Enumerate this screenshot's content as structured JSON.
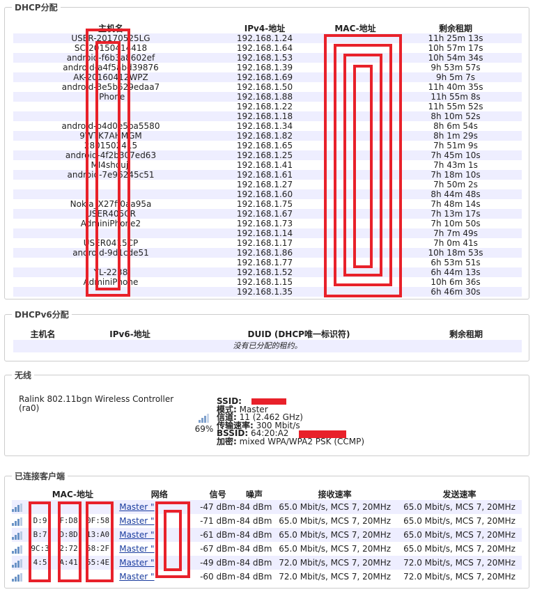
{
  "dhcp": {
    "title": "DHCP分配",
    "headers": [
      "主机名",
      "IPv4-地址",
      "MAC-地址",
      "剩余租期"
    ],
    "rows": [
      [
        "USER-20170525LG",
        "192.168.1.24",
        "",
        "11h 25m 13s"
      ],
      [
        "SC-20150414418",
        "192.168.1.64",
        "",
        "10h 57m 17s"
      ],
      [
        "android-f6b3a8602ef",
        "192.168.1.53",
        "",
        "10h 54m 34s"
      ],
      [
        "android-a4f5abd39876",
        "192.168.1.39",
        "",
        "9h 53m 57s"
      ],
      [
        "AK-20160412WPZ",
        "192.168.1.69",
        "",
        "9h 5m 7s"
      ],
      [
        "android-3e5b629edaa7",
        "192.168.1.50",
        "",
        "11h 40m 35s"
      ],
      [
        "iPhone",
        "192.168.1.88",
        "",
        "11h 55m 8s"
      ],
      [
        "",
        "192.168.1.22",
        "",
        "11h 55m 52s"
      ],
      [
        "",
        "192.168.1.18",
        "",
        "8h 10m 52s"
      ],
      [
        "android-b4d0e5ba5580",
        "192.168.1.34",
        "",
        "8h 6m 54s"
      ],
      [
        "9WTK7AHMGM",
        "192.168.1.82",
        "",
        "8h 1m 29s"
      ],
      [
        "2801502415",
        "192.168.1.65",
        "",
        "7h 51m 9s"
      ],
      [
        "android-4f2b307ed63",
        "192.168.1.25",
        "",
        "7h 45m 10s"
      ],
      [
        "MI4shouji",
        "192.168.1.41",
        "",
        "7h 43m 1s"
      ],
      [
        "android-7e96245c51",
        "192.168.1.61",
        "",
        "7h 18m 10s"
      ],
      [
        "",
        "192.168.1.27",
        "",
        "7h 50m 2s"
      ],
      [
        "",
        "192.168.1.60",
        "",
        "8h 44m 48s"
      ],
      [
        "Nokia_X27ff0aa95a",
        "192.168.1.75",
        "",
        "7h 48m 14s"
      ],
      [
        "USER405CR",
        "192.168.1.67",
        "",
        "7h 13m 17s"
      ],
      [
        "AdminiPhone2",
        "192.168.1.73",
        "",
        "7h 10m 50s"
      ],
      [
        "",
        "192.168.1.14",
        "",
        "7h 7m 49s"
      ],
      [
        "USER0415CP",
        "192.168.1.17",
        "",
        "7h 0m 41s"
      ],
      [
        "android-9d1cde51",
        "192.168.1.86",
        "",
        "10h 18m 53s"
      ],
      [
        "",
        "192.168.1.77",
        "",
        "6h 53m 51s"
      ],
      [
        "YL-2238",
        "192.168.1.52",
        "",
        "6h 44m 13s"
      ],
      [
        "AdminiPhone",
        "192.168.1.15",
        "",
        "10h 6m 36s"
      ],
      [
        "",
        "192.168.1.35",
        "",
        "6h 46m 30s"
      ]
    ]
  },
  "dhcpv6": {
    "title": "DHCPv6分配",
    "headers": [
      "主机名",
      "IPv6-地址",
      "DUID (DHCP唯一标识符)",
      "剩余租期"
    ],
    "empty_text": "没有已分配的租约。"
  },
  "wireless": {
    "title": "无线",
    "device_name": "Ralink 802.11bgn Wireless Controller",
    "device_id": "(ra0)",
    "signal_percent": "69%",
    "ssid_label": "SSID:",
    "ssid_value": "",
    "mode_label": "模式:",
    "mode_value": "Master",
    "channel_label": "信道:",
    "channel_value": "11 (2.462 GHz)",
    "rate_label": "传输速率:",
    "rate_value": "300 Mbit/s",
    "bssid_label": "BSSID:",
    "bssid_value": "64:20:A2",
    "enc_label": "加密:",
    "enc_value": "mixed WPA/WPA2 PSK (CCMP)"
  },
  "clients": {
    "title": "已连接客户端",
    "headers": [
      "MAC-地址",
      "网络",
      "信号",
      "噪声",
      "接收速率",
      "发送速率"
    ],
    "rows": [
      [
        "",
        "Master \"",
        "-47 dBm",
        "-84 dBm",
        "65.0 Mbit/s, MCS 7, 20MHz",
        "65.0 Mbit/s, MCS 7, 20MHz"
      ],
      [
        "",
        "Master \"",
        "-71 dBm",
        "-84 dBm",
        "65.0 Mbit/s, MCS 7, 20MHz",
        "65.0 Mbit/s, MCS 7, 20MHz"
      ],
      [
        "",
        "Master \"",
        "-61 dBm",
        "-84 dBm",
        "65.0 Mbit/s, MCS 7, 20MHz",
        "65.0 Mbit/s, MCS 7, 20MHz"
      ],
      [
        "",
        "Master \"",
        "-67 dBm",
        "-84 dBm",
        "65.0 Mbit/s, MCS 7, 20MHz",
        "65.0 Mbit/s, MCS 7, 20MHz"
      ],
      [
        "",
        "Master \"",
        "-49 dBm",
        "-84 dBm",
        "72.0 Mbit/s, MCS 7, 20MHz",
        "72.0 Mbit/s, MCS 7, 20MHz"
      ],
      [
        "",
        "Master \"",
        "-60 dBm",
        "-84 dBm",
        "72.0 Mbit/s, MCS 7, 20MHz",
        "72.0 Mbit/s, MCS 7, 20MHz"
      ]
    ],
    "mac_fragments": [
      [
        "",
        "",
        ""
      ],
      [
        "D:9",
        "F:D8",
        "0F:58"
      ],
      [
        "B:7",
        "D:8D",
        "13:A0"
      ],
      [
        "9C:3",
        "2:72",
        "58:2F"
      ],
      [
        "4:5",
        "A:41",
        "55:4E"
      ],
      [
        "",
        "",
        ""
      ]
    ]
  },
  "colors": {
    "accent": "#e8212a",
    "row_alt": "#eeeeff",
    "link": "#1a3c9e"
  }
}
